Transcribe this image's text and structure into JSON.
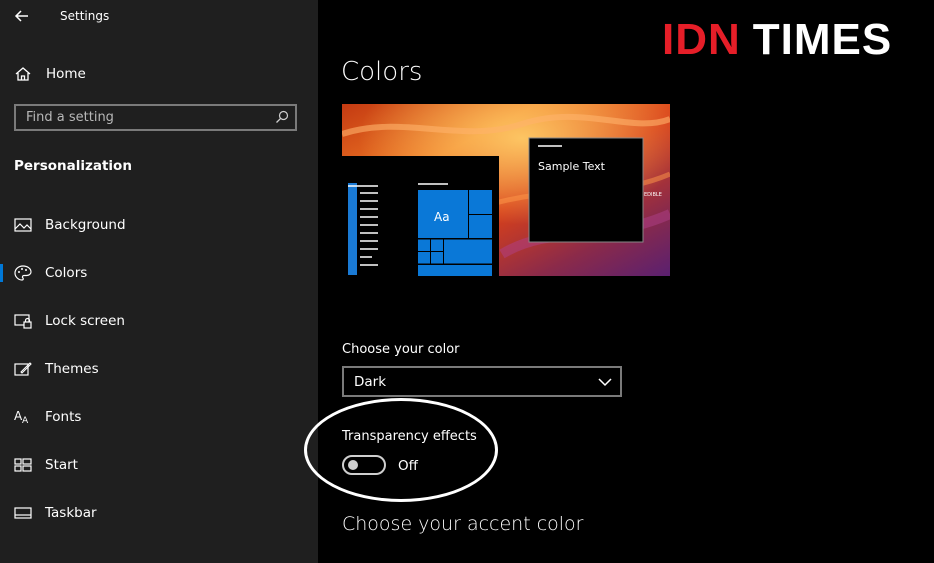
{
  "window": {
    "title": "Settings"
  },
  "sidebar": {
    "home_label": "Home",
    "search_placeholder": "Find a setting",
    "section": "Personalization",
    "items": [
      {
        "label": "Background",
        "icon": "picture-icon",
        "active": false
      },
      {
        "label": "Colors",
        "icon": "palette-icon",
        "active": true
      },
      {
        "label": "Lock screen",
        "icon": "lock-screen-icon",
        "active": false
      },
      {
        "label": "Themes",
        "icon": "themes-icon",
        "active": false
      },
      {
        "label": "Fonts",
        "icon": "fonts-icon",
        "active": false
      },
      {
        "label": "Start",
        "icon": "start-icon",
        "active": false
      },
      {
        "label": "Taskbar",
        "icon": "taskbar-icon",
        "active": false
      }
    ]
  },
  "main": {
    "title": "Colors",
    "preview": {
      "sample_text": "Sample Text",
      "tile_text": "Aa",
      "mini_text": "EDIBLE"
    },
    "choose_color": {
      "label": "Choose your color",
      "value": "Dark"
    },
    "transparency": {
      "label": "Transparency effects",
      "state": "Off"
    },
    "accent_title": "Choose your accent color"
  },
  "watermark": {
    "part1": "IDN",
    "part2": "TIMES"
  },
  "colors": {
    "accent": "#0078d7",
    "sidebar_bg": "#1f1f1f",
    "main_bg": "#000000",
    "logo_red": "#e61e28"
  }
}
